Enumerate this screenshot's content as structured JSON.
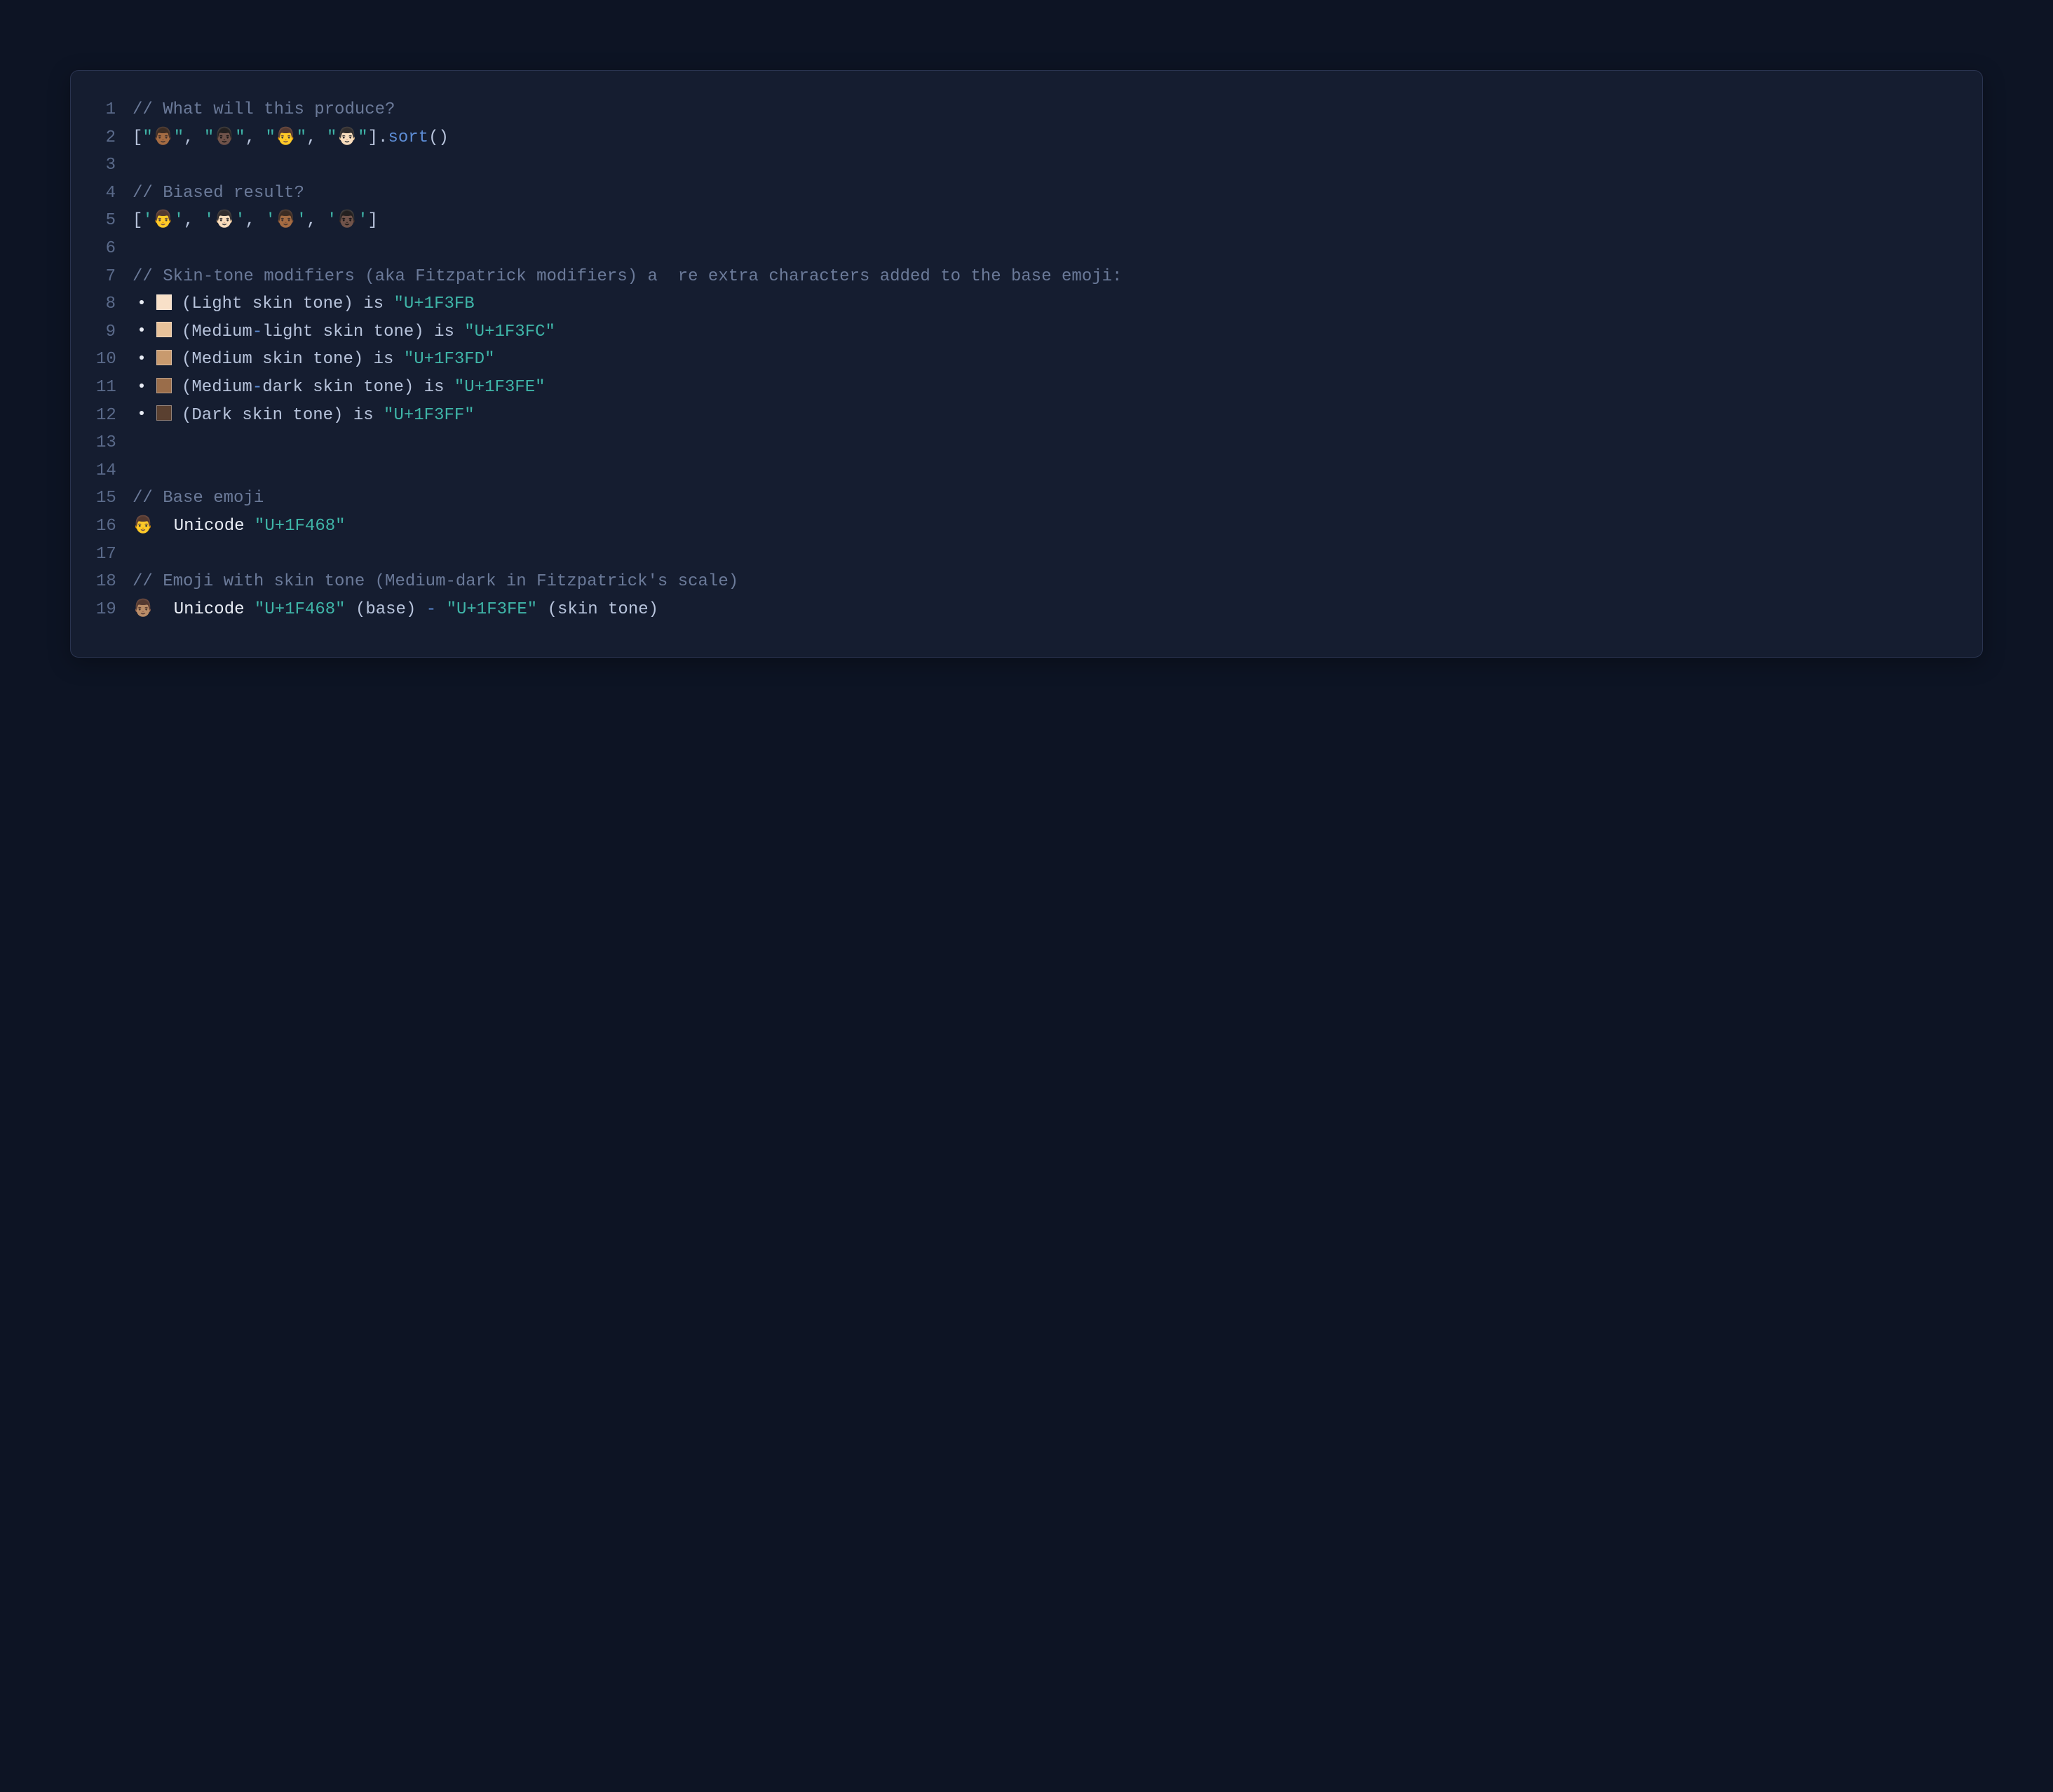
{
  "colors": {
    "light": "#f8e0c8",
    "medium_light": "#e8c29a",
    "medium": "#c89a6e",
    "medium_dark": "#9a6d4a",
    "dark": "#5a4030"
  },
  "lines": [
    {
      "n": "1",
      "tokens": [
        {
          "t": "comment",
          "v": "// What will this produce?"
        }
      ]
    },
    {
      "n": "2",
      "tokens": [
        {
          "t": "punct",
          "v": "["
        },
        {
          "t": "string",
          "v": "\""
        },
        {
          "t": "emoji",
          "v": "👨🏾"
        },
        {
          "t": "string",
          "v": "\""
        },
        {
          "t": "punct",
          "v": ", "
        },
        {
          "t": "string",
          "v": "\""
        },
        {
          "t": "emoji",
          "v": "👨🏿"
        },
        {
          "t": "string",
          "v": "\""
        },
        {
          "t": "punct",
          "v": ", "
        },
        {
          "t": "string",
          "v": "\""
        },
        {
          "t": "emoji",
          "v": "👨"
        },
        {
          "t": "string",
          "v": "\""
        },
        {
          "t": "punct",
          "v": ", "
        },
        {
          "t": "string",
          "v": "\""
        },
        {
          "t": "emoji",
          "v": "👨🏻"
        },
        {
          "t": "string",
          "v": "\""
        },
        {
          "t": "punct",
          "v": "]."
        },
        {
          "t": "method",
          "v": "sort"
        },
        {
          "t": "punct",
          "v": "()"
        }
      ]
    },
    {
      "n": "3",
      "tokens": []
    },
    {
      "n": "4",
      "tokens": [
        {
          "t": "comment",
          "v": "// Biased result?"
        }
      ]
    },
    {
      "n": "5",
      "tokens": [
        {
          "t": "punct",
          "v": "["
        },
        {
          "t": "string",
          "v": "'"
        },
        {
          "t": "emoji",
          "v": "👨"
        },
        {
          "t": "string",
          "v": "'"
        },
        {
          "t": "punct",
          "v": ", "
        },
        {
          "t": "string",
          "v": "'"
        },
        {
          "t": "emoji",
          "v": "👨🏻"
        },
        {
          "t": "string",
          "v": "'"
        },
        {
          "t": "punct",
          "v": ", "
        },
        {
          "t": "string",
          "v": "'"
        },
        {
          "t": "emoji",
          "v": "👨🏾"
        },
        {
          "t": "string",
          "v": "'"
        },
        {
          "t": "punct",
          "v": ", "
        },
        {
          "t": "string",
          "v": "'"
        },
        {
          "t": "emoji",
          "v": "👨🏿"
        },
        {
          "t": "string",
          "v": "'"
        },
        {
          "t": "punct",
          "v": "]"
        }
      ]
    },
    {
      "n": "6",
      "tokens": []
    },
    {
      "n": "7",
      "tokens": [
        {
          "t": "comment",
          "v": "// Skin-tone modifiers (aka Fitzpatrick modifiers) a  re extra characters added to the base emoji:"
        }
      ]
    },
    {
      "n": "8",
      "tokens": [
        {
          "t": "bullet"
        },
        {
          "t": "swatch",
          "c": "light"
        },
        {
          "t": "punct",
          "v": "(Light skin tone) is "
        },
        {
          "t": "string",
          "v": "\"U+1F3FB"
        }
      ]
    },
    {
      "n": "9",
      "tokens": [
        {
          "t": "bullet"
        },
        {
          "t": "swatch",
          "c": "medium_light"
        },
        {
          "t": "punct",
          "v": "(Medium"
        },
        {
          "t": "dash",
          "v": "-"
        },
        {
          "t": "punct",
          "v": "light skin tone) is "
        },
        {
          "t": "string",
          "v": "\"U+1F3FC\""
        }
      ]
    },
    {
      "n": "10",
      "tokens": [
        {
          "t": "bullet"
        },
        {
          "t": "swatch",
          "c": "medium"
        },
        {
          "t": "punct",
          "v": "(Medium skin tone) is "
        },
        {
          "t": "string",
          "v": "\"U+1F3FD\""
        }
      ]
    },
    {
      "n": "11",
      "tokens": [
        {
          "t": "bullet"
        },
        {
          "t": "swatch",
          "c": "medium_dark"
        },
        {
          "t": "punct",
          "v": "(Medium"
        },
        {
          "t": "dash",
          "v": "-"
        },
        {
          "t": "punct",
          "v": "dark skin tone) is "
        },
        {
          "t": "string",
          "v": "\"U+1F3FE\""
        }
      ]
    },
    {
      "n": "12",
      "tokens": [
        {
          "t": "bullet"
        },
        {
          "t": "swatch",
          "c": "dark"
        },
        {
          "t": "punct",
          "v": "(Dark skin tone) is "
        },
        {
          "t": "string",
          "v": "\"U+1F3FF\""
        }
      ]
    },
    {
      "n": "13",
      "tokens": []
    },
    {
      "n": "14",
      "tokens": []
    },
    {
      "n": "15",
      "tokens": [
        {
          "t": "comment",
          "v": "// Base emoji"
        }
      ]
    },
    {
      "n": "16",
      "tokens": [
        {
          "t": "emoji",
          "v": "👨"
        },
        {
          "t": "plain",
          "v": "  Unicode "
        },
        {
          "t": "string",
          "v": "\"U+1F468\""
        }
      ]
    },
    {
      "n": "17",
      "tokens": []
    },
    {
      "n": "18",
      "tokens": [
        {
          "t": "comment",
          "v": "// Emoji with skin tone (Medium-dark in Fitzpatrick's scale)"
        }
      ]
    },
    {
      "n": "19",
      "tokens": [
        {
          "t": "emoji",
          "v": "👨🏽"
        },
        {
          "t": "plain",
          "v": "  Unicode "
        },
        {
          "t": "string",
          "v": "\"U+1F468\""
        },
        {
          "t": "punct",
          "v": " (base) "
        },
        {
          "t": "dash",
          "v": "-"
        },
        {
          "t": "punct",
          "v": " "
        },
        {
          "t": "string",
          "v": "\"U+1F3FE\""
        },
        {
          "t": "punct",
          "v": " (skin tone)"
        }
      ]
    }
  ]
}
